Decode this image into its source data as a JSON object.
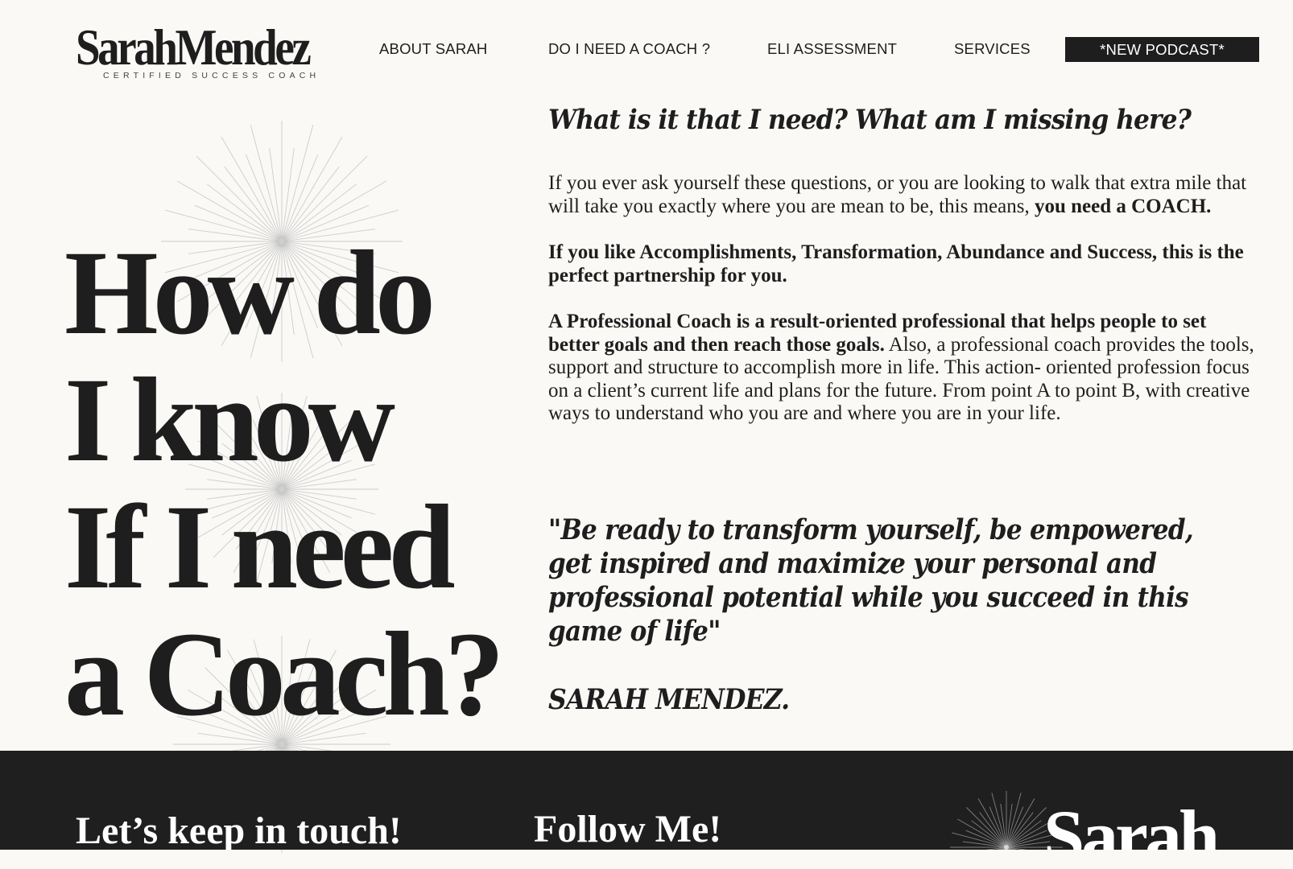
{
  "brand": {
    "name": "SarahMendez",
    "tagline": "CERTIFIED SUCCESS COACH"
  },
  "nav": {
    "items": [
      {
        "label": "ABOUT SARAH"
      },
      {
        "label": "DO I NEED A COACH ?"
      },
      {
        "label": "ELI ASSESSMENT"
      },
      {
        "label": "SERVICES"
      }
    ],
    "cta_label": "*NEW PODCAST*"
  },
  "hero": {
    "lines": [
      "How do",
      "I know",
      "If I need",
      "a Coach?"
    ]
  },
  "main": {
    "question": "What is it that I need? What am I missing here?",
    "p1_normal": "If you ever ask yourself these questions, or you are looking to walk that extra mile that will take you exactly where you are mean to be, this means, ",
    "p1_bold": "you need a COACH.",
    "p2": "If you like Accomplishments, Transformation, Abundance and Success, this is the perfect partnership for you.",
    "p3_bold": "A Professional Coach is a result-oriented professional that helps people to set better goals and then reach those goals.",
    "p3_normal": " Also, a professional coach provides the tools, support and structure to accomplish more in life. This action- oriented profession focus on a client’s current life and plans for the future. From point A to point B, with creative ways to understand who you are and where you are in your life.",
    "quote": " \"Be ready to transform yourself, be empowered, get inspired and maximize your personal and professional potential while you succeed in this game of life\"",
    "signature": "SARAH MENDEZ."
  },
  "footer": {
    "keep_in_touch": "Let’s keep in touch!",
    "follow": "Follow Me!",
    "logo_partial": "Sarah"
  },
  "colors": {
    "background": "#faf9f6",
    "text": "#1e1e1e",
    "footer_bg": "#1f1f1f",
    "starburst": "#bdbdbd"
  }
}
